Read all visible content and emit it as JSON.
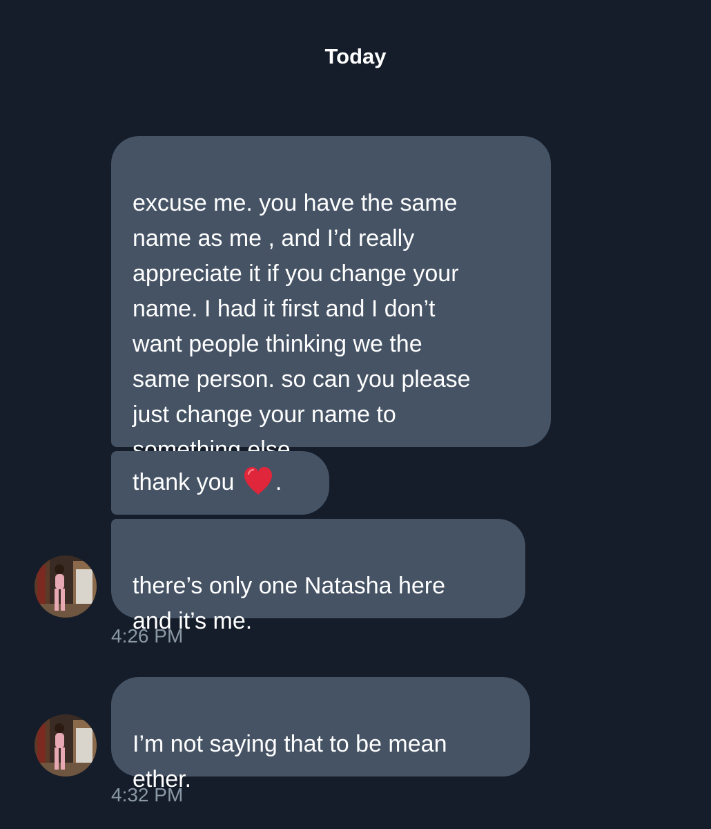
{
  "header": {
    "day_label": "Today"
  },
  "messages": [
    {
      "text": "excuse me. you have the same\nname as me , and I’d really\nappreciate it if you change your\nname. I had it first and I don’t\nwant people thinking we the\nsame person. so can you please\njust change your name to\nsomething else."
    },
    {
      "text_before": "thank you ",
      "emoji": "red-heart-icon",
      "text_after": "."
    },
    {
      "text": "there’s only one Natasha here\nand it’s me.",
      "time": "4:26 PM"
    },
    {
      "text": "I’m not saying that to be mean\nether.",
      "time": "4:32 PM"
    }
  ],
  "colors": {
    "background": "#151d2a",
    "bubble": "#455365",
    "text": "#ffffff",
    "timestamp": "#8b98a5",
    "heart": "#e0263a"
  }
}
